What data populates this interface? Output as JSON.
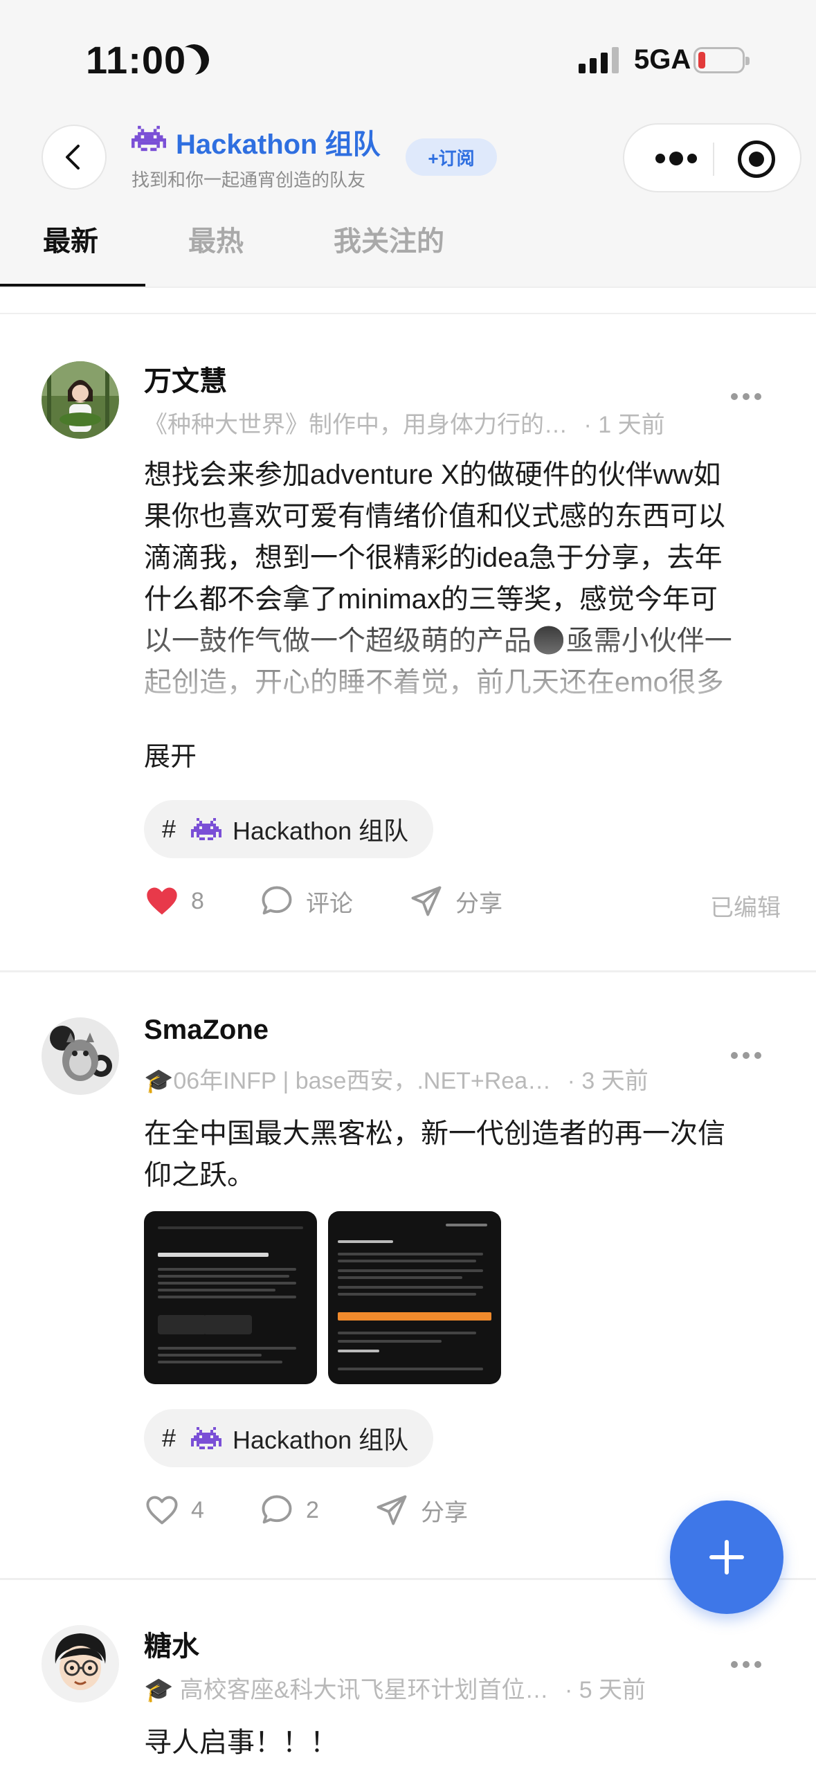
{
  "status_bar": {
    "time": "11:00",
    "network": "5GA"
  },
  "header": {
    "title": "Hackathon 组队",
    "subtitle": "找到和你一起通宵创造的队友",
    "subscribe_label": "+订阅",
    "group_icon": "space-invader-icon",
    "accent": "#2f6fe0"
  },
  "tabs": [
    {
      "label": "最新",
      "active": true
    },
    {
      "label": "最热",
      "active": false
    },
    {
      "label": "我关注的",
      "active": false
    }
  ],
  "posts": [
    {
      "author": "万文慧",
      "meta": "《种种大世界》制作中，用身体力行的…",
      "time": "· 1 天前",
      "content_lines": [
        "想找会来参加adventure X的做硬件的伙伴ww如",
        "果你也喜欢可爱有情绪价值和仪式感的东西可以",
        "滴滴我，想到一个很精彩的idea急于分享，去年",
        "什么都不会拿了minimax的三等奖，感觉今年可",
        "以一鼓作气做一个超级萌的产品🥺亟需小伙伴一",
        "起创造，开心的睡不着觉，前几天还在emo很多"
      ],
      "expand_label": "展开",
      "tag": "Hackathon 组队",
      "likes": "8",
      "liked": true,
      "comment_label": "评论",
      "share_label": "分享",
      "edited_label": "已编辑"
    },
    {
      "author": "SmaZone",
      "meta_icon": "graduation-cap-icon",
      "meta": "06年INFP | base西安，.NET+Rea…",
      "time": "· 3 天前",
      "content_lines": [
        "在全中国最大黑客松，新一代创造者的再一次信",
        "仰之跃。"
      ],
      "images": [
        {
          "caption": "恭喜你获得 AdventureX 2026 的创造者席位!"
        },
        {
          "caption": "/ SEAT CONFIRMED"
        }
      ],
      "tag": "Hackathon 组队",
      "likes": "4",
      "comments": "2",
      "share_label": "分享"
    },
    {
      "author": "糖水",
      "meta_icon": "graduation-cap-icon",
      "meta": "高校客座&科大讯飞星环计划首位…",
      "time": "· 5 天前",
      "content_lines": [
        "寻人启事！！！"
      ]
    }
  ],
  "colors": {
    "like_red": "#e8394a",
    "fab_blue": "#3e77e8"
  }
}
